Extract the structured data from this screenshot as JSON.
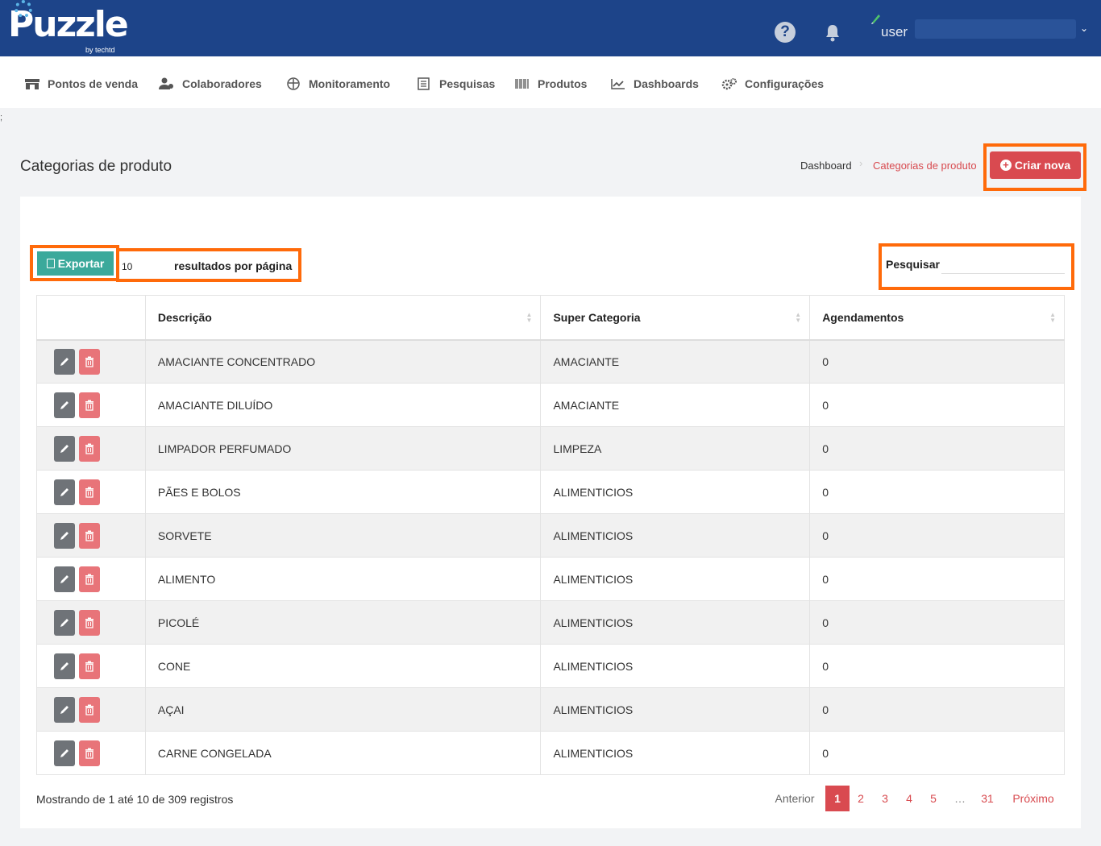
{
  "header": {
    "logo_text": "Puzzle",
    "logo_sub": "by techtd",
    "help_glyph": "?",
    "user_label": "user",
    "chevron": "⌄"
  },
  "nav": {
    "items": [
      {
        "label": "Pontos de venda",
        "icon": "store-icon"
      },
      {
        "label": "Colaboradores",
        "icon": "users-icon"
      },
      {
        "label": "Monitoramento",
        "icon": "monitor-icon"
      },
      {
        "label": "Pesquisas",
        "icon": "survey-icon"
      },
      {
        "label": "Produtos",
        "icon": "barcode-icon"
      },
      {
        "label": "Dashboards",
        "icon": "chart-icon"
      },
      {
        "label": "Configurações",
        "icon": "gears-icon"
      }
    ]
  },
  "page": {
    "stray_text": ";",
    "title": "Categorias de produto",
    "breadcrumb": {
      "home": "Dashboard",
      "separator": "›",
      "current": "Categorias de produto"
    },
    "create_button": "Criar nova",
    "create_plus": "+"
  },
  "toolbar": {
    "export_label": "Exportar",
    "per_page_value": "10",
    "per_page_label": "resultados por página",
    "search_label": "Pesquisar",
    "search_value": ""
  },
  "table": {
    "columns": [
      "",
      "Descrição",
      "Super Categoria",
      "Agendamentos"
    ],
    "rows": [
      {
        "descricao": "AMACIANTE CONCENTRADO",
        "super": "AMACIANTE",
        "agend": "0"
      },
      {
        "descricao": "AMACIANTE DILUÍDO",
        "super": "AMACIANTE",
        "agend": "0"
      },
      {
        "descricao": "LIMPADOR PERFUMADO",
        "super": "LIMPEZA",
        "agend": "0"
      },
      {
        "descricao": "PÃES E BOLOS",
        "super": "ALIMENTICIOS",
        "agend": "0"
      },
      {
        "descricao": "SORVETE",
        "super": "ALIMENTICIOS",
        "agend": "0"
      },
      {
        "descricao": "ALIMENTO",
        "super": "ALIMENTICIOS",
        "agend": "0"
      },
      {
        "descricao": "PICOLÉ",
        "super": "ALIMENTICIOS",
        "agend": "0"
      },
      {
        "descricao": "CONE",
        "super": "ALIMENTICIOS",
        "agend": "0"
      },
      {
        "descricao": "AÇAI",
        "super": "ALIMENTICIOS",
        "agend": "0"
      },
      {
        "descricao": "CARNE CONGELADA",
        "super": "ALIMENTICIOS",
        "agend": "0"
      }
    ]
  },
  "footer": {
    "info": "Mostrando de 1 até 10 de 309 registros",
    "prev": "Anterior",
    "pages": [
      "1",
      "2",
      "3",
      "4",
      "5"
    ],
    "dots": "…",
    "last": "31",
    "next": "Próximo"
  },
  "colors": {
    "topbar": "#1d4489",
    "accent_red": "#d94a50",
    "export_green": "#3ba99b",
    "highlight": "#ff6a0a"
  }
}
